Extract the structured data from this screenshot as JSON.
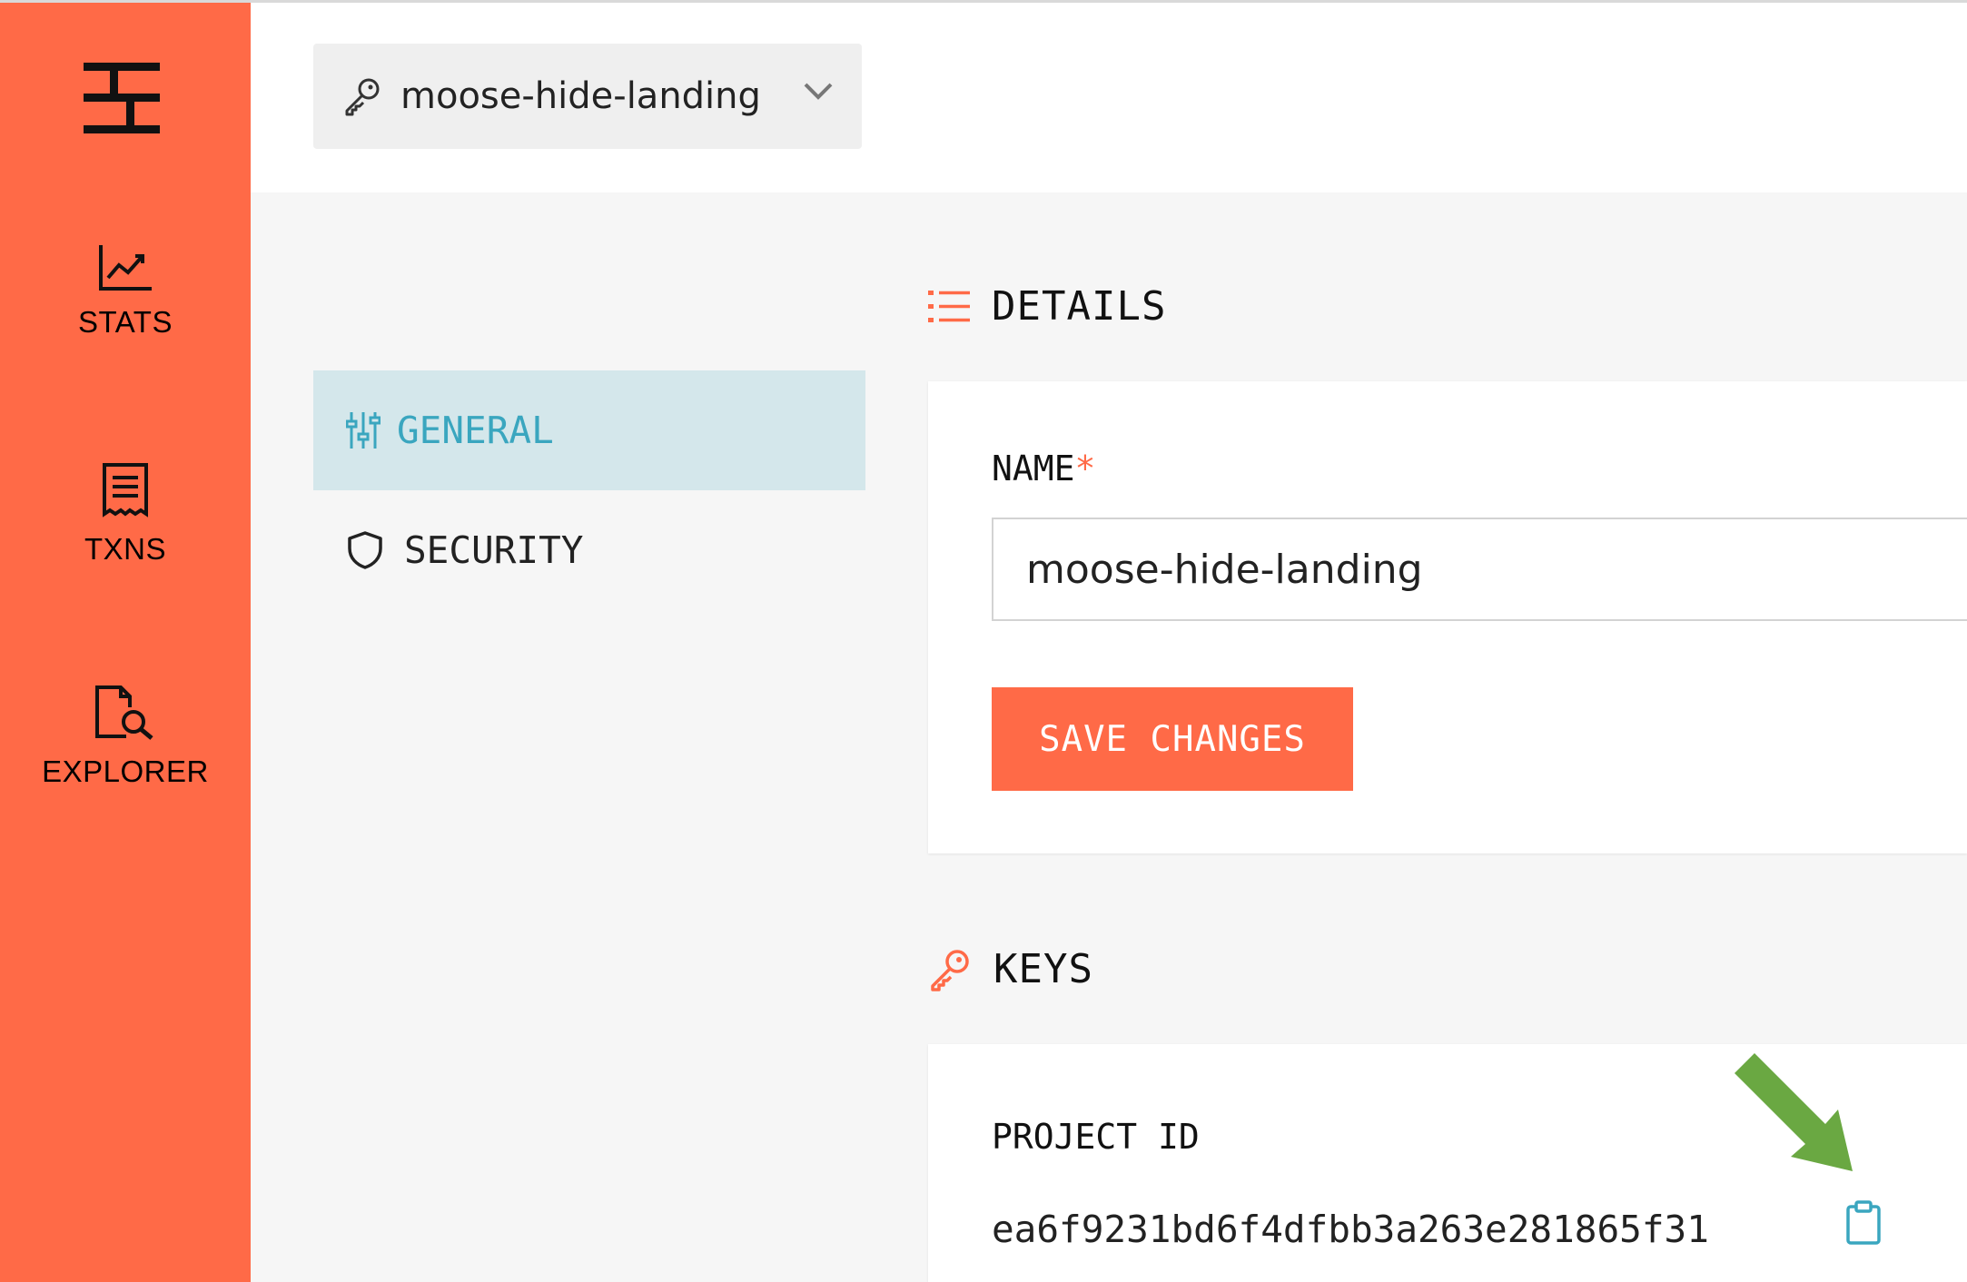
{
  "sidebar": {
    "items": [
      {
        "label": "STATS",
        "icon": "chart-icon"
      },
      {
        "label": "TXNS",
        "icon": "receipt-icon"
      },
      {
        "label": "EXPLORER",
        "icon": "file-search-icon"
      }
    ]
  },
  "header": {
    "project_selector": {
      "value": "moose-hide-landing",
      "icon": "key-icon"
    }
  },
  "settings_nav": {
    "items": [
      {
        "label": "GENERAL",
        "icon": "sliders-icon",
        "active": true
      },
      {
        "label": "SECURITY",
        "icon": "shield-icon",
        "active": false
      }
    ]
  },
  "details": {
    "title": "DETAILS",
    "name_label": "NAME",
    "required_mark": "*",
    "name_value": "moose-hide-landing",
    "save_label": "SAVE CHANGES"
  },
  "keys": {
    "title": "KEYS",
    "project_id_label": "PROJECT ID",
    "project_id_value": "ea6f9231bd6f4dfbb3a263e281865f31"
  },
  "colors": {
    "brand": "#ff6a47",
    "active_nav_bg": "#d4e7eb",
    "active_nav_text": "#3aa6bf",
    "annotation_arrow": "#6aa842"
  }
}
